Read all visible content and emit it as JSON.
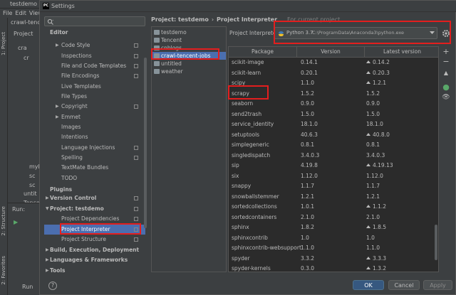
{
  "ide": {
    "title": "testdemo [C",
    "menu": [
      "File",
      "Edit",
      "View"
    ],
    "project_tree": [
      "crawl-tence",
      "Project",
      "cra",
      "cr",
      "myl",
      "sc",
      "sc",
      "untit",
      "Tencen"
    ],
    "tool_tabs": [
      "1: Project",
      "2: Structure",
      "2: Favorites"
    ],
    "run_tab": "Run:",
    "run_button": "Run"
  },
  "dialog": {
    "title": "Settings",
    "search_placeholder": "",
    "nav": [
      {
        "label": "Editor",
        "bold": true
      },
      {
        "label": "Code Style",
        "arrow": true,
        "copy": true
      },
      {
        "label": "Inspections",
        "copy": true
      },
      {
        "label": "File and Code Templates",
        "copy": true
      },
      {
        "label": "File Encodings",
        "copy": true
      },
      {
        "label": "Live Templates"
      },
      {
        "label": "File Types"
      },
      {
        "label": "Copyright",
        "arrow": true,
        "copy": true
      },
      {
        "label": "Emmet",
        "arrow": true
      },
      {
        "label": "Images"
      },
      {
        "label": "Intentions"
      },
      {
        "label": "Language Injections",
        "copy": true
      },
      {
        "label": "Spelling",
        "copy": true
      },
      {
        "label": "TextMate Bundles"
      },
      {
        "label": "TODO"
      },
      {
        "label": "Plugins",
        "bold": true
      },
      {
        "label": "Version Control",
        "bold": true,
        "arrow": true,
        "copy": true
      },
      {
        "label": "Project: testdemo",
        "bold": true,
        "arrow": true,
        "expanded": true,
        "copy": true
      },
      {
        "label": "Project Dependencies",
        "sub": true,
        "copy": true
      },
      {
        "label": "Project Interpreter",
        "sub": true,
        "selected": true,
        "copy": true
      },
      {
        "label": "Project Structure",
        "sub": true,
        "copy": true
      },
      {
        "label": "Build, Execution, Deployment",
        "bold": true,
        "arrow": true
      },
      {
        "label": "Languages & Frameworks",
        "bold": true,
        "arrow": true
      },
      {
        "label": "Tools",
        "bold": true,
        "arrow": true
      }
    ],
    "breadcrumb": {
      "project": "Project: testdemo",
      "separator": "›",
      "page": "Project Interpreter",
      "for_current": "For current project"
    },
    "projects": [
      {
        "label": "testdemo"
      },
      {
        "label": "Tencent"
      },
      {
        "label": "cnblogs"
      },
      {
        "label": "crawl-tencent-jobs",
        "selected": true
      },
      {
        "label": "untitled"
      },
      {
        "label": "weather"
      }
    ],
    "interpreter_label": "Project Interpreter:",
    "interpreter_name": "Python 3.7",
    "interpreter_path": "C:\\ProgramData\\Anaconda3\\python.exe",
    "table": {
      "headers": [
        "Package",
        "Version",
        "Latest version"
      ],
      "rows": [
        {
          "package": "scikit-image",
          "version": "0.14.1",
          "latest": "0.14.2",
          "upgrade": true
        },
        {
          "package": "scikit-learn",
          "version": "0.20.1",
          "latest": "0.20.3",
          "upgrade": true
        },
        {
          "package": "scipy",
          "version": "1.1.0",
          "latest": "1.2.1",
          "upgrade": true
        },
        {
          "package": "scrapy",
          "version": "1.5.2",
          "latest": "1.5.2",
          "upgrade": false
        },
        {
          "package": "seaborn",
          "version": "0.9.0",
          "latest": "0.9.0",
          "upgrade": false
        },
        {
          "package": "send2trash",
          "version": "1.5.0",
          "latest": "1.5.0",
          "upgrade": false
        },
        {
          "package": "service_identity",
          "version": "18.1.0",
          "latest": "18.1.0",
          "upgrade": false
        },
        {
          "package": "setuptools",
          "version": "40.6.3",
          "latest": "40.8.0",
          "upgrade": true
        },
        {
          "package": "simplegeneric",
          "version": "0.8.1",
          "latest": "0.8.1",
          "upgrade": false
        },
        {
          "package": "singledispatch",
          "version": "3.4.0.3",
          "latest": "3.4.0.3",
          "upgrade": false
        },
        {
          "package": "sip",
          "version": "4.19.8",
          "latest": "4.19.13",
          "upgrade": true
        },
        {
          "package": "six",
          "version": "1.12.0",
          "latest": "1.12.0",
          "upgrade": false
        },
        {
          "package": "snappy",
          "version": "1.1.7",
          "latest": "1.1.7",
          "upgrade": false
        },
        {
          "package": "snowballstemmer",
          "version": "1.2.1",
          "latest": "1.2.1",
          "upgrade": false
        },
        {
          "package": "sortedcollections",
          "version": "1.0.1",
          "latest": "1.1.2",
          "upgrade": true
        },
        {
          "package": "sortedcontainers",
          "version": "2.1.0",
          "latest": "2.1.0",
          "upgrade": false
        },
        {
          "package": "sphinx",
          "version": "1.8.2",
          "latest": "1.8.5",
          "upgrade": true
        },
        {
          "package": "sphinxcontrib",
          "version": "1.0",
          "latest": "1.0",
          "upgrade": false
        },
        {
          "package": "sphinxcontrib-websupport",
          "version": "1.1.0",
          "latest": "1.1.0",
          "upgrade": false
        },
        {
          "package": "spyder",
          "version": "3.3.2",
          "latest": "3.3.3",
          "upgrade": true
        },
        {
          "package": "spyder-kernels",
          "version": "0.3.0",
          "latest": "1.3.2",
          "upgrade": true
        }
      ]
    },
    "side_tools": [
      "+",
      "−",
      "▲",
      "●",
      "👁"
    ],
    "buttons": {
      "ok": "OK",
      "cancel": "Cancel",
      "apply": "Apply",
      "help": "?"
    }
  },
  "colors": {
    "selection": "#4b6eaf",
    "highlight_box": "#e31e1e",
    "ok_button": "#365880",
    "background": "#3c3f41",
    "table_bg": "#2b2b2b"
  }
}
